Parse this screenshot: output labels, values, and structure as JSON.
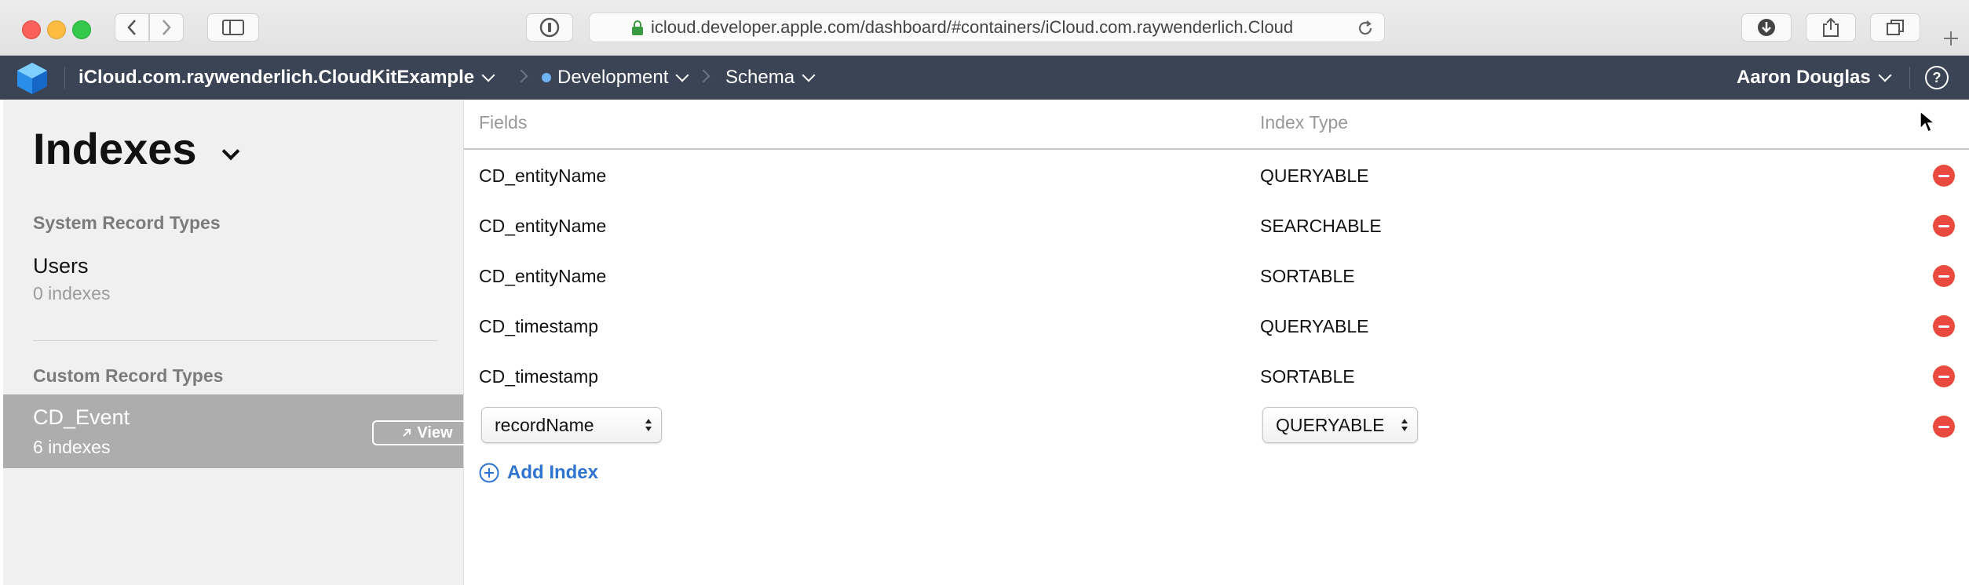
{
  "browser": {
    "url": "icloud.developer.apple.com/dashboard/#containers/iCloud.com.raywenderlich.Cloud"
  },
  "navbar": {
    "container": "iCloud.com.raywenderlich.CloudKitExample",
    "environment": "Development",
    "section": "Schema",
    "user": "Aaron Douglas",
    "help_glyph": "?"
  },
  "sidebar": {
    "title": "Indexes",
    "system_section": "System Record Types",
    "system_types": [
      {
        "name": "Users",
        "count": "0 indexes"
      }
    ],
    "custom_section": "Custom Record Types",
    "custom_types": [
      {
        "name": "CD_Event",
        "count": "6 indexes",
        "action": "View"
      }
    ]
  },
  "table": {
    "columns": [
      "Fields",
      "Index Type"
    ],
    "rows": [
      {
        "field": "CD_entityName",
        "type": "QUERYABLE"
      },
      {
        "field": "CD_entityName",
        "type": "SEARCHABLE"
      },
      {
        "field": "CD_entityName",
        "type": "SORTABLE"
      },
      {
        "field": "CD_timestamp",
        "type": "QUERYABLE"
      },
      {
        "field": "CD_timestamp",
        "type": "SORTABLE"
      }
    ],
    "new_row": {
      "field": "recordName",
      "type": "QUERYABLE"
    },
    "add_label": "Add Index"
  },
  "colors": {
    "navbar_bg": "#3b4455",
    "accent_blue": "#2f74d0",
    "remove_red": "#e9493f",
    "selected_gray": "#adadad"
  },
  "icons": [
    "back-icon",
    "forward-icon",
    "sidebar-icon",
    "password-icon",
    "lock-icon",
    "reload-icon",
    "download-icon",
    "share-icon",
    "tabs-icon",
    "new-tab-icon",
    "cloudkit-logo",
    "help-icon",
    "remove-icon",
    "add-icon",
    "cursor-icon"
  ]
}
